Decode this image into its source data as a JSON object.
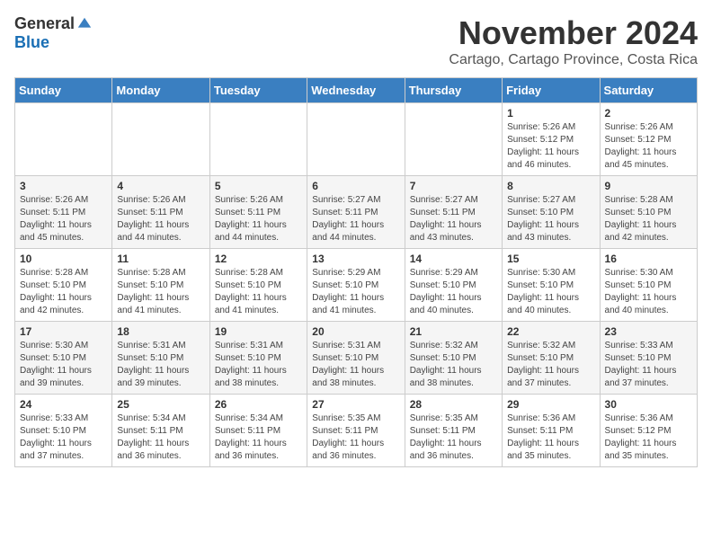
{
  "header": {
    "logo_general": "General",
    "logo_blue": "Blue",
    "month": "November 2024",
    "location": "Cartago, Cartago Province, Costa Rica"
  },
  "weekdays": [
    "Sunday",
    "Monday",
    "Tuesday",
    "Wednesday",
    "Thursday",
    "Friday",
    "Saturday"
  ],
  "weeks": [
    [
      {
        "day": "",
        "info": ""
      },
      {
        "day": "",
        "info": ""
      },
      {
        "day": "",
        "info": ""
      },
      {
        "day": "",
        "info": ""
      },
      {
        "day": "",
        "info": ""
      },
      {
        "day": "1",
        "info": "Sunrise: 5:26 AM\nSunset: 5:12 PM\nDaylight: 11 hours\nand 46 minutes."
      },
      {
        "day": "2",
        "info": "Sunrise: 5:26 AM\nSunset: 5:12 PM\nDaylight: 11 hours\nand 45 minutes."
      }
    ],
    [
      {
        "day": "3",
        "info": "Sunrise: 5:26 AM\nSunset: 5:11 PM\nDaylight: 11 hours\nand 45 minutes."
      },
      {
        "day": "4",
        "info": "Sunrise: 5:26 AM\nSunset: 5:11 PM\nDaylight: 11 hours\nand 44 minutes."
      },
      {
        "day": "5",
        "info": "Sunrise: 5:26 AM\nSunset: 5:11 PM\nDaylight: 11 hours\nand 44 minutes."
      },
      {
        "day": "6",
        "info": "Sunrise: 5:27 AM\nSunset: 5:11 PM\nDaylight: 11 hours\nand 44 minutes."
      },
      {
        "day": "7",
        "info": "Sunrise: 5:27 AM\nSunset: 5:11 PM\nDaylight: 11 hours\nand 43 minutes."
      },
      {
        "day": "8",
        "info": "Sunrise: 5:27 AM\nSunset: 5:10 PM\nDaylight: 11 hours\nand 43 minutes."
      },
      {
        "day": "9",
        "info": "Sunrise: 5:28 AM\nSunset: 5:10 PM\nDaylight: 11 hours\nand 42 minutes."
      }
    ],
    [
      {
        "day": "10",
        "info": "Sunrise: 5:28 AM\nSunset: 5:10 PM\nDaylight: 11 hours\nand 42 minutes."
      },
      {
        "day": "11",
        "info": "Sunrise: 5:28 AM\nSunset: 5:10 PM\nDaylight: 11 hours\nand 41 minutes."
      },
      {
        "day": "12",
        "info": "Sunrise: 5:28 AM\nSunset: 5:10 PM\nDaylight: 11 hours\nand 41 minutes."
      },
      {
        "day": "13",
        "info": "Sunrise: 5:29 AM\nSunset: 5:10 PM\nDaylight: 11 hours\nand 41 minutes."
      },
      {
        "day": "14",
        "info": "Sunrise: 5:29 AM\nSunset: 5:10 PM\nDaylight: 11 hours\nand 40 minutes."
      },
      {
        "day": "15",
        "info": "Sunrise: 5:30 AM\nSunset: 5:10 PM\nDaylight: 11 hours\nand 40 minutes."
      },
      {
        "day": "16",
        "info": "Sunrise: 5:30 AM\nSunset: 5:10 PM\nDaylight: 11 hours\nand 40 minutes."
      }
    ],
    [
      {
        "day": "17",
        "info": "Sunrise: 5:30 AM\nSunset: 5:10 PM\nDaylight: 11 hours\nand 39 minutes."
      },
      {
        "day": "18",
        "info": "Sunrise: 5:31 AM\nSunset: 5:10 PM\nDaylight: 11 hours\nand 39 minutes."
      },
      {
        "day": "19",
        "info": "Sunrise: 5:31 AM\nSunset: 5:10 PM\nDaylight: 11 hours\nand 38 minutes."
      },
      {
        "day": "20",
        "info": "Sunrise: 5:31 AM\nSunset: 5:10 PM\nDaylight: 11 hours\nand 38 minutes."
      },
      {
        "day": "21",
        "info": "Sunrise: 5:32 AM\nSunset: 5:10 PM\nDaylight: 11 hours\nand 38 minutes."
      },
      {
        "day": "22",
        "info": "Sunrise: 5:32 AM\nSunset: 5:10 PM\nDaylight: 11 hours\nand 37 minutes."
      },
      {
        "day": "23",
        "info": "Sunrise: 5:33 AM\nSunset: 5:10 PM\nDaylight: 11 hours\nand 37 minutes."
      }
    ],
    [
      {
        "day": "24",
        "info": "Sunrise: 5:33 AM\nSunset: 5:10 PM\nDaylight: 11 hours\nand 37 minutes."
      },
      {
        "day": "25",
        "info": "Sunrise: 5:34 AM\nSunset: 5:11 PM\nDaylight: 11 hours\nand 36 minutes."
      },
      {
        "day": "26",
        "info": "Sunrise: 5:34 AM\nSunset: 5:11 PM\nDaylight: 11 hours\nand 36 minutes."
      },
      {
        "day": "27",
        "info": "Sunrise: 5:35 AM\nSunset: 5:11 PM\nDaylight: 11 hours\nand 36 minutes."
      },
      {
        "day": "28",
        "info": "Sunrise: 5:35 AM\nSunset: 5:11 PM\nDaylight: 11 hours\nand 36 minutes."
      },
      {
        "day": "29",
        "info": "Sunrise: 5:36 AM\nSunset: 5:11 PM\nDaylight: 11 hours\nand 35 minutes."
      },
      {
        "day": "30",
        "info": "Sunrise: 5:36 AM\nSunset: 5:12 PM\nDaylight: 11 hours\nand 35 minutes."
      }
    ]
  ]
}
